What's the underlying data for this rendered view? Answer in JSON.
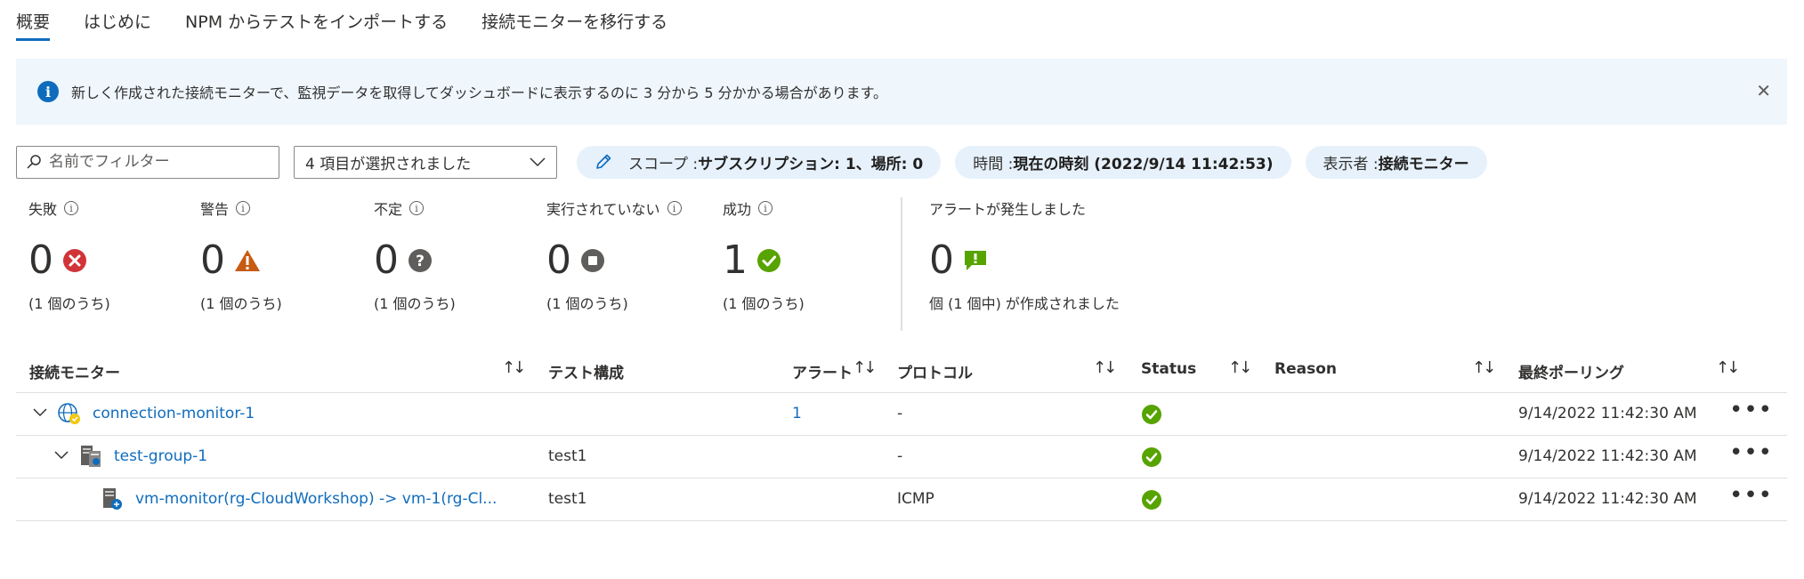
{
  "tabs": [
    {
      "label": "概要",
      "active": true
    },
    {
      "label": "はじめに"
    },
    {
      "label": "NPM からテストをインポートする"
    },
    {
      "label": "接続モニターを移行する"
    }
  ],
  "banner": {
    "text": "新しく作成された接続モニターで、監視データを取得してダッシュボードに表示するのに 3 分から 5 分かかる場合があります。",
    "icon": "info-icon",
    "close_icon": "close-icon"
  },
  "filters": {
    "search_placeholder": "名前でフィルター",
    "select_value": "4 項目が選択されました",
    "scope_label": "スコープ : ",
    "scope_value": "サブスクリプション: 1、場所: 0",
    "time_label": "時間 : ",
    "time_value": "現在の時刻 (2022/9/14 11:42:53)",
    "viewer_label": "表示者 : ",
    "viewer_value": "接続モニター"
  },
  "summary": {
    "failed": {
      "title": "失敗",
      "count": "0",
      "sub": "(1 個のうち)"
    },
    "warning": {
      "title": "警告",
      "count": "0",
      "sub": "(1 個のうち)"
    },
    "indeterminate": {
      "title": "不定",
      "count": "0",
      "sub": "(1 個のうち)"
    },
    "not_running": {
      "title": "実行されていない",
      "count": "0",
      "sub": "(1 個のうち)"
    },
    "success": {
      "title": "成功",
      "count": "1",
      "sub": "(1 個のうち)"
    },
    "alerts": {
      "title": "アラートが発生しました",
      "count": "0",
      "sub": "個 (1 個中) が作成されました"
    }
  },
  "table": {
    "headers": {
      "monitor": "接続モニター",
      "test_config": "テスト構成",
      "alerts": "アラート",
      "protocol": "プロトコル",
      "status": "Status",
      "reason": "Reason",
      "last_polled": "最終ポーリング"
    },
    "rows": [
      {
        "name": "connection-monitor-1",
        "test_config": "",
        "alerts": "1",
        "protocol": "-",
        "last_polled": "9/14/2022 11:42:30 AM"
      },
      {
        "name": "test-group-1",
        "test_config": "test1",
        "alerts": "",
        "protocol": "-",
        "last_polled": "9/14/2022 11:42:30 AM"
      },
      {
        "name": "vm-monitor(rg-CloudWorkshop) -> vm-1(rg-Cl...",
        "test_config": "test1",
        "alerts": "",
        "protocol": "ICMP",
        "last_polled": "9/14/2022 11:42:30 AM"
      }
    ],
    "more_label": "•••",
    "sort_glyph": "↑↓"
  },
  "colors": {
    "accent": "#0f6cbd",
    "banner_bg": "#eff6fc",
    "pill_bg": "#e6f1fb",
    "fail": "#d13438",
    "warn": "#c75b12",
    "unknown": "#605e5c",
    "success": "#57a300"
  }
}
